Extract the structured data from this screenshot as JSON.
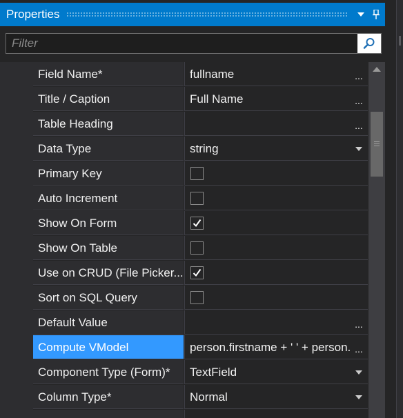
{
  "panel": {
    "title": "Properties",
    "menu_icon": "dropdown-triangle-icon",
    "pin_icon": "pin-icon",
    "accent_color": "#007acc",
    "selected_color": "#3399ff"
  },
  "filter": {
    "placeholder": "Filter",
    "value": "",
    "icon": "search-icon"
  },
  "properties": [
    {
      "name": "Field Name*",
      "value": "fullname",
      "editor": "ellipsis"
    },
    {
      "name": "Title / Caption",
      "value": "Full Name",
      "editor": "ellipsis"
    },
    {
      "name": "Table Heading",
      "value": "",
      "editor": "ellipsis"
    },
    {
      "name": "Data Type",
      "value": "string",
      "editor": "dropdown"
    },
    {
      "name": "Primary Key",
      "checked": false,
      "editor": "checkbox"
    },
    {
      "name": "Auto Increment",
      "checked": false,
      "editor": "checkbox"
    },
    {
      "name": "Show On Form",
      "checked": true,
      "editor": "checkbox"
    },
    {
      "name": "Show On Table",
      "checked": false,
      "editor": "checkbox"
    },
    {
      "name": "Use on CRUD (File Picker...",
      "checked": true,
      "editor": "checkbox"
    },
    {
      "name": "Sort on SQL Query",
      "checked": false,
      "editor": "checkbox"
    },
    {
      "name": "Default Value",
      "value": "",
      "editor": "ellipsis"
    },
    {
      "name": "Compute VModel",
      "value": "person.firstname + ' ' + person.lastname",
      "editor": "ellipsis",
      "selected": true
    },
    {
      "name": "Component Type (Form)*",
      "value": "TextField",
      "editor": "dropdown"
    },
    {
      "name": "Column Type*",
      "value": "Normal",
      "editor": "dropdown"
    },
    {
      "name": "",
      "value": "",
      "editor": "none"
    }
  ],
  "editor_glyphs": {
    "ellipsis": "..."
  }
}
